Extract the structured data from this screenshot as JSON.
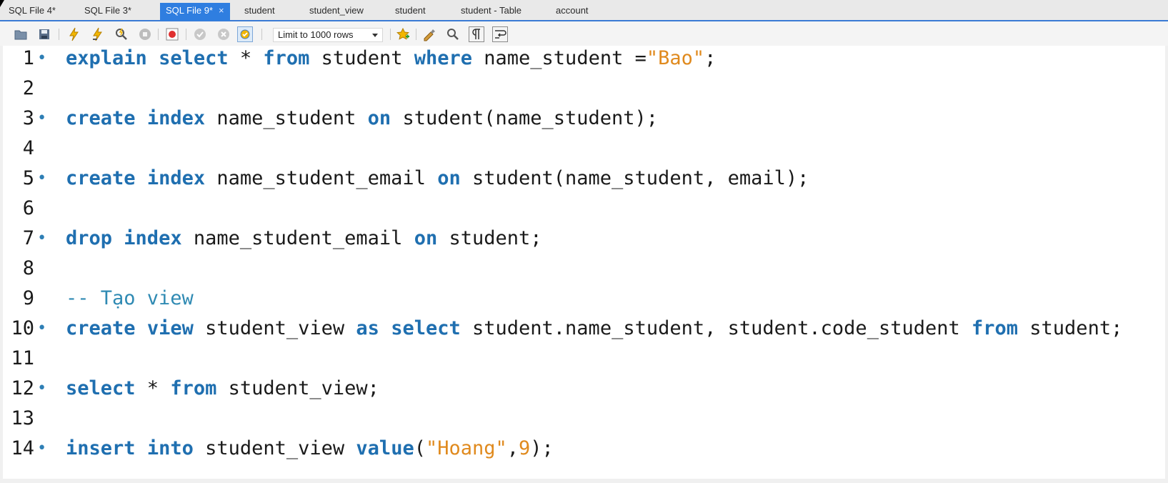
{
  "tabs": [
    {
      "label": "SQL File 4*",
      "active": false
    },
    {
      "label": "SQL File 3*",
      "active": false
    },
    {
      "label": "SQL File 9*",
      "active": true,
      "close": "×"
    },
    {
      "label": "student",
      "active": false
    },
    {
      "label": "student_view",
      "active": false
    },
    {
      "label": "student",
      "active": false
    },
    {
      "label": "student - Table",
      "active": false
    },
    {
      "label": "account",
      "active": false
    }
  ],
  "toolbar": {
    "limit_label": "Limit to 1000 rows",
    "icons": [
      "open-folder-icon",
      "save-icon",
      "execute-icon",
      "execute-current-icon",
      "explain-icon",
      "stop-icon",
      "toggle-error-icon",
      "commit-icon",
      "rollback-icon",
      "autocommit-icon",
      "bookmark-icon",
      "beautify-icon",
      "find-icon",
      "invisible-chars-icon",
      "wrap-icon"
    ]
  },
  "colors": {
    "keyword": "#1f6fb0",
    "string": "#e08a1e",
    "comment": "#2f8ab3",
    "tab_active": "#2f7ee0"
  },
  "editor": {
    "lines": [
      {
        "n": "1",
        "dot": true,
        "tokens": [
          [
            "kw",
            "explain"
          ],
          [
            "t",
            " "
          ],
          [
            "kw",
            "select"
          ],
          [
            "t",
            " * "
          ],
          [
            "kw",
            "from"
          ],
          [
            "t",
            " student "
          ],
          [
            "kw",
            "where"
          ],
          [
            "t",
            " name_student ="
          ],
          [
            "str",
            "\"Bao\""
          ],
          [
            "t",
            ";"
          ]
        ]
      },
      {
        "n": "2",
        "dot": false,
        "tokens": []
      },
      {
        "n": "3",
        "dot": true,
        "tokens": [
          [
            "kw",
            "create"
          ],
          [
            "t",
            " "
          ],
          [
            "kw",
            "index"
          ],
          [
            "t",
            " name_student "
          ],
          [
            "kw",
            "on"
          ],
          [
            "t",
            " student(name_student);"
          ]
        ]
      },
      {
        "n": "4",
        "dot": false,
        "tokens": []
      },
      {
        "n": "5",
        "dot": true,
        "tokens": [
          [
            "kw",
            "create"
          ],
          [
            "t",
            " "
          ],
          [
            "kw",
            "index"
          ],
          [
            "t",
            " name_student_email "
          ],
          [
            "kw",
            "on"
          ],
          [
            "t",
            " student(name_student, email);"
          ]
        ]
      },
      {
        "n": "6",
        "dot": false,
        "tokens": []
      },
      {
        "n": "7",
        "dot": true,
        "tokens": [
          [
            "kw",
            "drop"
          ],
          [
            "t",
            " "
          ],
          [
            "kw",
            "index"
          ],
          [
            "t",
            " name_student_email "
          ],
          [
            "kw",
            "on"
          ],
          [
            "t",
            " student;"
          ]
        ]
      },
      {
        "n": "8",
        "dot": false,
        "tokens": []
      },
      {
        "n": "9",
        "dot": false,
        "tokens": [
          [
            "cmt",
            "-- Tạo view"
          ]
        ]
      },
      {
        "n": "10",
        "dot": true,
        "tokens": [
          [
            "kw",
            "create"
          ],
          [
            "t",
            " "
          ],
          [
            "kw",
            "view"
          ],
          [
            "t",
            " student_view "
          ],
          [
            "kw",
            "as"
          ],
          [
            "t",
            " "
          ],
          [
            "kw",
            "select"
          ],
          [
            "t",
            " student.name_student, student.code_student "
          ],
          [
            "kw",
            "from"
          ],
          [
            "t",
            " student;"
          ]
        ]
      },
      {
        "n": "11",
        "dot": false,
        "tokens": []
      },
      {
        "n": "12",
        "dot": true,
        "tokens": [
          [
            "kw",
            "select"
          ],
          [
            "t",
            " * "
          ],
          [
            "kw",
            "from"
          ],
          [
            "t",
            " student_view;"
          ]
        ]
      },
      {
        "n": "13",
        "dot": false,
        "tokens": []
      },
      {
        "n": "14",
        "dot": true,
        "tokens": [
          [
            "kw",
            "insert"
          ],
          [
            "t",
            " "
          ],
          [
            "kw",
            "into"
          ],
          [
            "t",
            " student_view "
          ],
          [
            "kw",
            "value"
          ],
          [
            "t",
            "("
          ],
          [
            "str",
            "\"Hoang\""
          ],
          [
            "t",
            ","
          ],
          [
            "num",
            "9"
          ],
          [
            "t",
            ");"
          ]
        ]
      }
    ]
  }
}
